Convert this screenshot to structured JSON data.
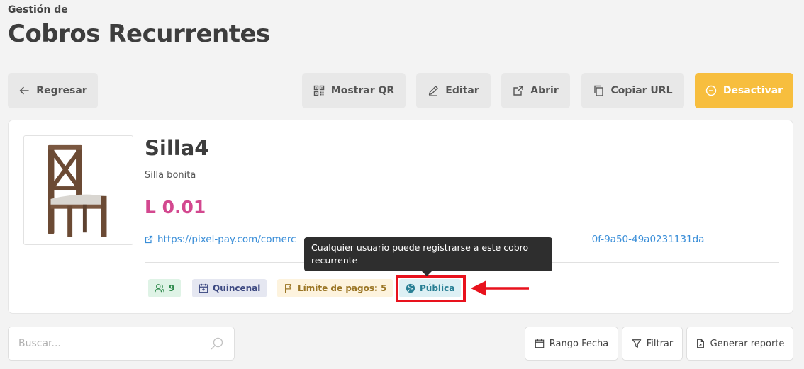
{
  "header": {
    "pretitle": "Gestión de",
    "title": "Cobros Recurrentes"
  },
  "toolbar": {
    "back_label": "Regresar",
    "qr_label": "Mostrar QR",
    "edit_label": "Editar",
    "open_label": "Abrir",
    "copy_label": "Copiar URL",
    "deactivate_label": "Desactivar"
  },
  "product": {
    "name": "Silla4",
    "description": "Silla bonita",
    "price": "L 0.01",
    "link_start": "https://pixel-pay.com/comerc",
    "link_end": "0f-9a50-49a0231131da"
  },
  "badges": {
    "users_count": "9",
    "frequency": "Quincenal",
    "limit": "Límite de pagos: 5",
    "visibility": "Pública"
  },
  "tooltip": {
    "text": "Cualquier usuario puede registrarse a este cobro recurrente"
  },
  "search": {
    "placeholder": "Buscar..."
  },
  "actions": {
    "date_range_label": "Rango Fecha",
    "filter_label": "Filtrar",
    "report_label": "Generar reporte"
  },
  "colors": {
    "accent_price": "#d3488f",
    "deactivate_bg": "#f7be3e",
    "link": "#3a8ed8",
    "highlight": "#e8121d"
  }
}
